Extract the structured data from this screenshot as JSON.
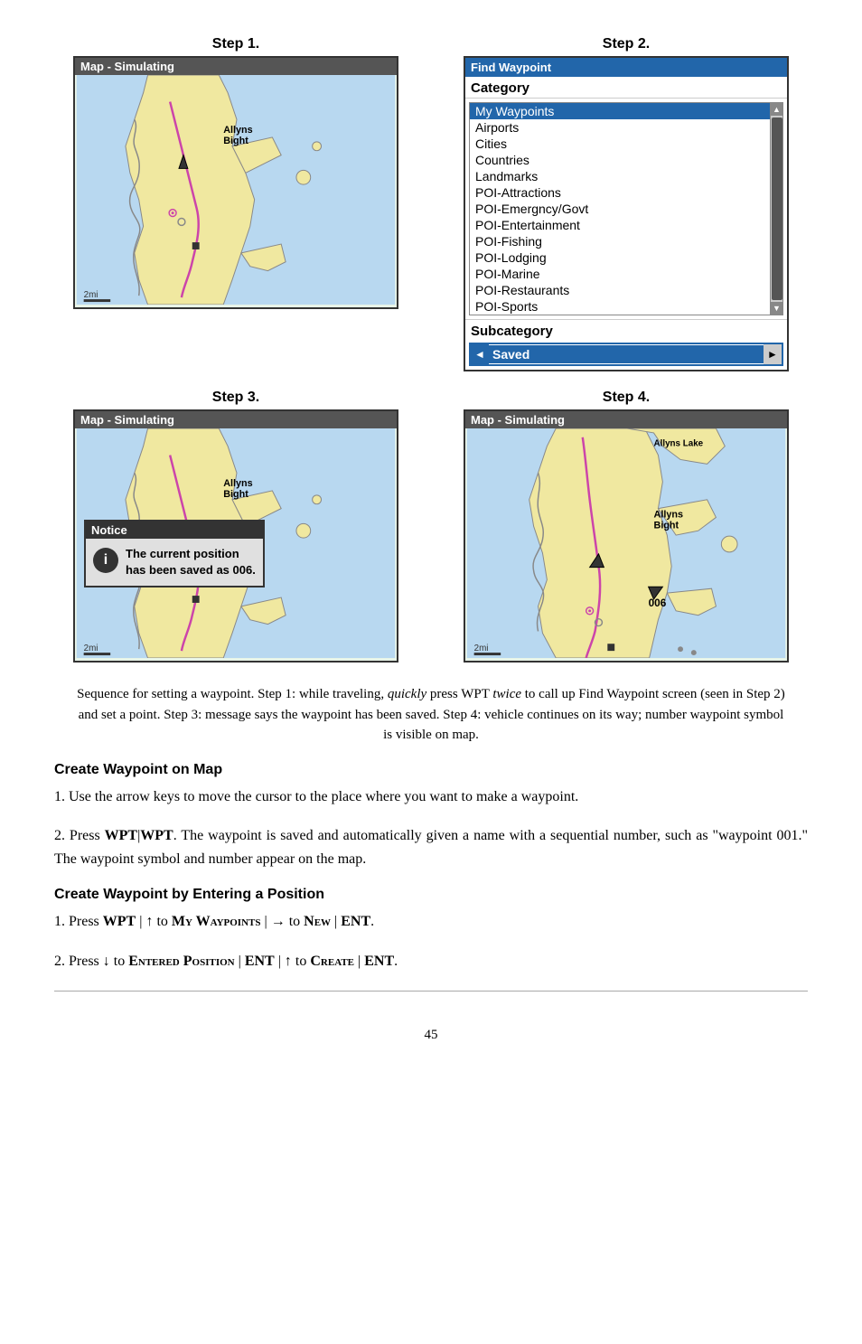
{
  "steps": [
    {
      "label": "Step 1.",
      "type": "map",
      "title": "Map - Simulating"
    },
    {
      "label": "Step 2.",
      "type": "find-waypoint"
    },
    {
      "label": "Step 3.",
      "type": "map-notice",
      "title": "Map - Simulating"
    },
    {
      "label": "Step 4.",
      "type": "map2",
      "title": "Map - Simulating"
    }
  ],
  "find_waypoint": {
    "title": "Find Waypoint",
    "category_label": "Category",
    "items": [
      "My  Waypoints",
      "Airports",
      "Cities",
      "Countries",
      "Landmarks",
      "POI-Attractions",
      "POI-Emergncy/Govt",
      "POI-Entertainment",
      "POI-Fishing",
      "POI-Lodging",
      "POI-Marine",
      "POI-Restaurants",
      "POI-Sports"
    ],
    "subcategory_label": "Subcategory",
    "saved_label": "Saved"
  },
  "notice": {
    "title": "Notice",
    "icon": "i",
    "text": "The current position has been saved as 006."
  },
  "caption": "Sequence for setting a waypoint. Step 1: while traveling, quickly press WPT twice to call up Find Waypoint screen (seen in Step 2) and set a point. Step 3: message says the waypoint has been saved. Step 4: vehicle continues on its way; number waypoint symbol is visible on map.",
  "section1": {
    "heading": "Create Waypoint on Map",
    "para1": "1. Use the arrow keys to move the cursor to the place where you want to make a waypoint.",
    "para2": "2. Press WPT|WPT. The waypoint is saved and automatically given a name with a sequential number, such as \"waypoint 001.\" The waypoint symbol and number appear on the map."
  },
  "section2": {
    "heading": "Create Waypoint by Entering a Position",
    "para1_parts": [
      "1. Press ",
      "WPT",
      " | ",
      "↑",
      " to ",
      "My Waypoints",
      " | ",
      "→",
      " to ",
      "New",
      " | ",
      "ENT",
      "."
    ],
    "para2_parts": [
      "2. Press ",
      "↓",
      " to ",
      "Entered Position",
      " | ",
      "ENT",
      " | ",
      "↑",
      " to ",
      "Create",
      " | ",
      "ENT",
      "."
    ]
  },
  "page_number": "45"
}
